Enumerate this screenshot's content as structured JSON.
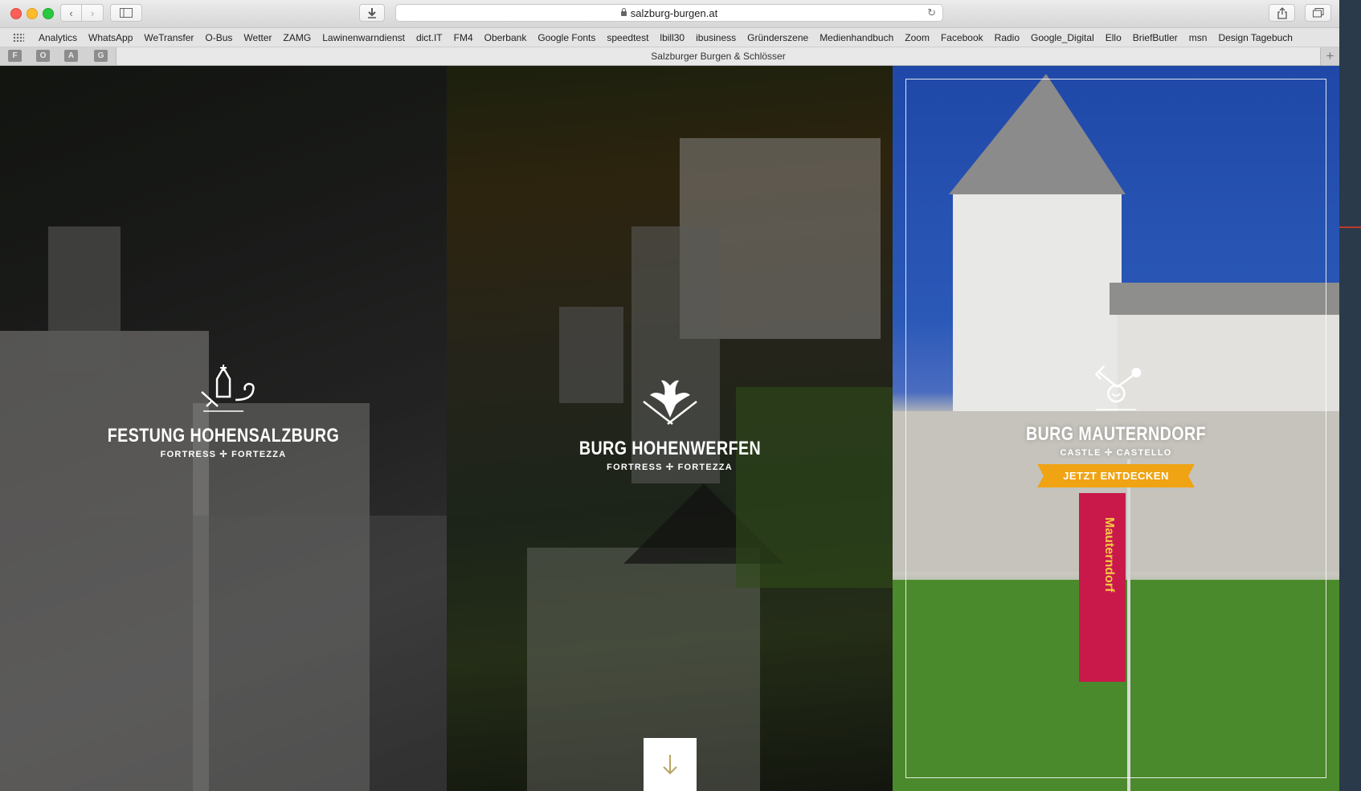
{
  "browser": {
    "url": "salzburg-burgen.at",
    "tab_title": "Salzburger Burgen & Schlösser",
    "pinned_tabs": [
      "F",
      "O",
      "A",
      "G"
    ],
    "new_tab_label": "+"
  },
  "bookmarks": [
    "Analytics",
    "WhatsApp",
    "WeTransfer",
    "O-Bus",
    "Wetter",
    "ZAMG",
    "Lawinenwarndienst",
    "dict.IT",
    "FM4",
    "Oberbank",
    "Google Fonts",
    "speedtest",
    "lbill30",
    "ibusiness",
    "Gründerszene",
    "Medienhandbuch",
    "Zoom",
    "Facebook",
    "Radio",
    "Google_Digital",
    "Ello",
    "BriefButler",
    "msn",
    "Design Tagebuch"
  ],
  "castles": [
    {
      "title": "FESTUNG HOHENSALZBURG",
      "subtitle": "FORTRESS ✢ FORTEZZA",
      "icon": "salzburg-crest-icon"
    },
    {
      "title": "BURG HOHENWERFEN",
      "subtitle": "FORTRESS ✢ FORTEZZA",
      "icon": "eagle-swords-icon"
    },
    {
      "title": "BURG MAUTERNDORF",
      "subtitle": "CASTLE ✢ CASTELLO",
      "icon": "mauterndorf-crest-icon",
      "cta": "JETZT ENTDECKEN",
      "banner_text": "Mauterndorf"
    }
  ],
  "colors": {
    "cta": "#f0a313",
    "banner": "#c9194a"
  },
  "scroll_icon": "arrow-down-icon"
}
